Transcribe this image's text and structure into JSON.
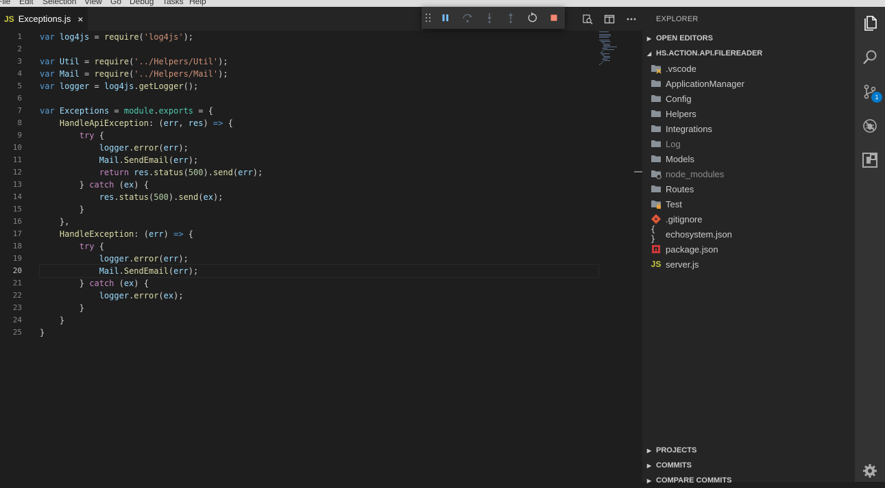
{
  "menubar": {
    "items": [
      "File",
      "Edit",
      "Selection",
      "View",
      "Go",
      "Debug",
      "Tasks",
      "Help"
    ]
  },
  "tab": {
    "badge": "JS",
    "label": "Exceptions.js",
    "close": "×"
  },
  "editor": {
    "line_numbers": [
      "1",
      "2",
      "3",
      "4",
      "5",
      "6",
      "7",
      "8",
      "9",
      "10",
      "11",
      "12",
      "13",
      "14",
      "15",
      "16",
      "17",
      "18",
      "19",
      "20",
      "21",
      "22",
      "23",
      "24",
      "25"
    ],
    "current_line": 20
  },
  "sidebar": {
    "title": "EXPLORER",
    "sections": {
      "open_editors": "OPEN EDITORS",
      "project": "HS.ACTION.API.FILEREADER",
      "projects": "PROJECTS",
      "commits": "COMMITS",
      "compare_commits": "COMPARE COMMITS"
    },
    "tree": [
      {
        "label": ".vscode",
        "icon": "folder-vscode-icon"
      },
      {
        "label": "ApplicationManager",
        "icon": "folder-icon"
      },
      {
        "label": "Config",
        "icon": "folder-icon"
      },
      {
        "label": "Helpers",
        "icon": "folder-icon"
      },
      {
        "label": "Integrations",
        "icon": "folder-icon"
      },
      {
        "label": "Log",
        "icon": "folder-icon"
      },
      {
        "label": "Models",
        "icon": "folder-icon"
      },
      {
        "label": "node_modules",
        "icon": "folder-node-icon"
      },
      {
        "label": "Routes",
        "icon": "folder-icon"
      },
      {
        "label": "Test",
        "icon": "folder-test-icon"
      },
      {
        "label": ".gitignore",
        "icon": "git-icon"
      },
      {
        "label": "echosystem.json",
        "icon": "json-braces-icon"
      },
      {
        "label": "package.json",
        "icon": "npm-icon"
      },
      {
        "label": "server.js",
        "icon": "js-file-icon"
      }
    ]
  },
  "activitybar": {
    "scm_badge": "1"
  },
  "colors": {
    "accent": "#007acc",
    "pause": "#75beff",
    "stop": "#f48771",
    "js": "#cbcb41"
  }
}
